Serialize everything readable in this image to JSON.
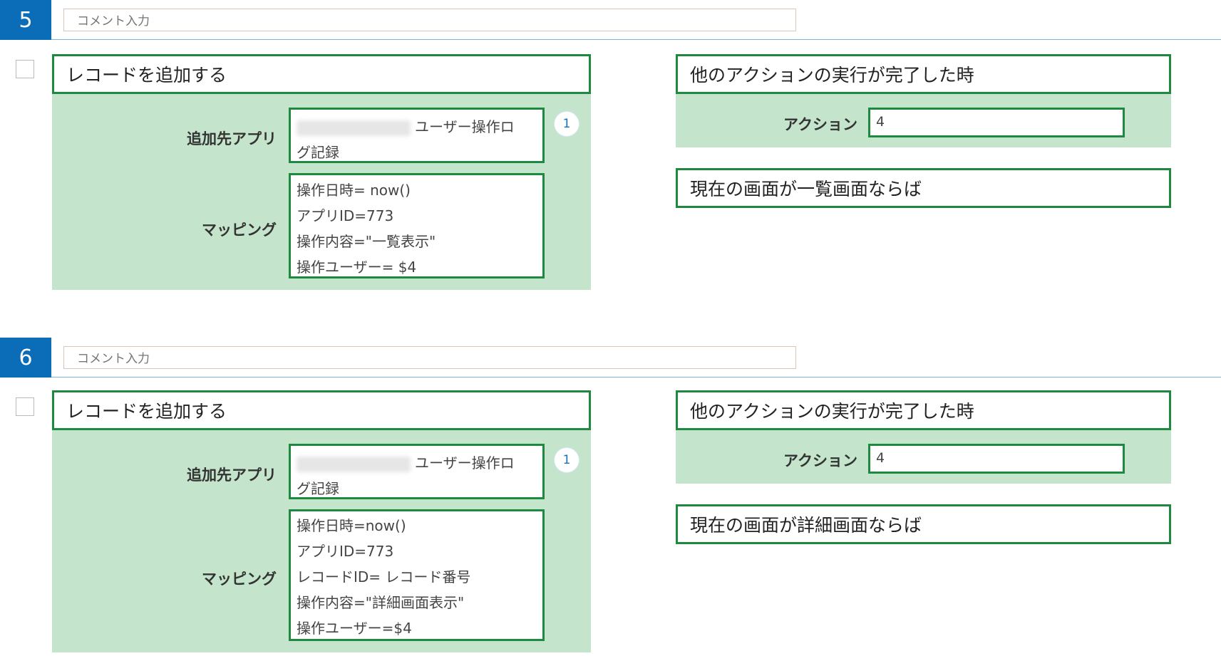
{
  "rules": [
    {
      "number": "5",
      "comment_placeholder": "コメント入力",
      "action_title": "レコードを追加する",
      "target_app_label": "追加先アプリ",
      "target_app_value_line1": "ユーザー操作ロ",
      "target_app_value_line2": "グ記録",
      "badge": "1",
      "mapping_label": "マッピング",
      "mapping_lines": [
        "操作日時= now()",
        "アプリID=773",
        "操作内容=\"一覧表示\"",
        "操作ユーザー= $4"
      ],
      "trigger_title": "他のアクションの実行が完了した時",
      "action_label": "アクション",
      "action_value": "4",
      "condition_title": "現在の画面が一覧画面ならば"
    },
    {
      "number": "6",
      "comment_placeholder": "コメント入力",
      "action_title": "レコードを追加する",
      "target_app_label": "追加先アプリ",
      "target_app_value_line1": "ユーザー操作ロ",
      "target_app_value_line2": "グ記録",
      "badge": "1",
      "mapping_label": "マッピング",
      "mapping_lines": [
        "操作日時=now()",
        "アプリID=773",
        "レコードID= レコード番号",
        "操作内容=\"詳細画面表示\"",
        "操作ユーザー=$4"
      ],
      "trigger_title": "他のアクションの実行が完了した時",
      "action_label": "アクション",
      "action_value": "4",
      "condition_title": "現在の画面が詳細画面ならば"
    }
  ]
}
